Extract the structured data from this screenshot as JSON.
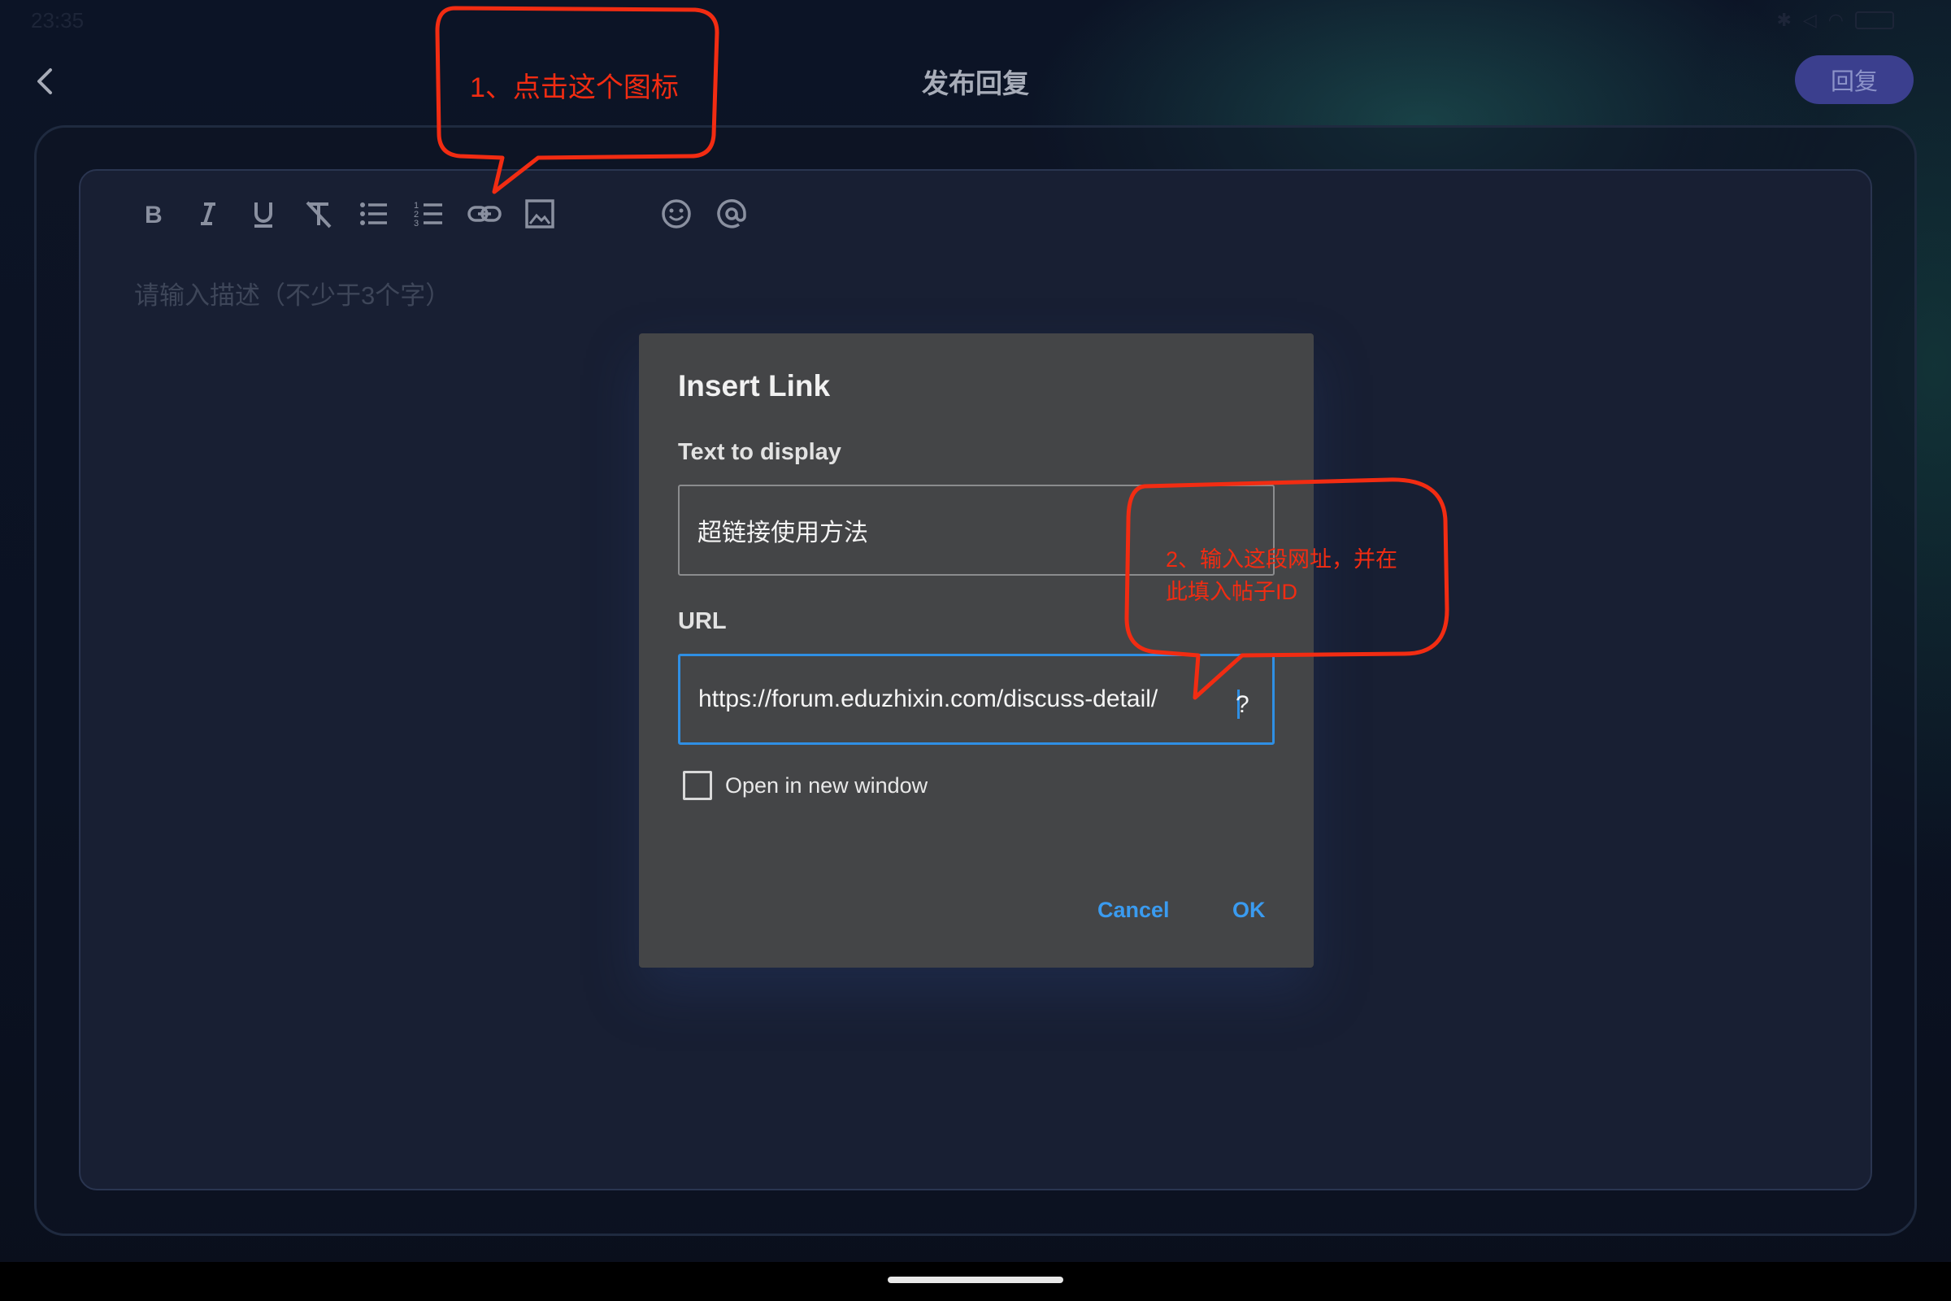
{
  "status_bar": {
    "time": "23:35",
    "icons": [
      "bluetooth-icon",
      "mute-icon",
      "wifi-icon",
      "battery-icon"
    ]
  },
  "header": {
    "title": "发布回复",
    "reply_button": "回复",
    "back_icon": "chevron-left-icon"
  },
  "editor": {
    "placeholder": "请输入描述（不少于3个字）",
    "toolbar": [
      {
        "name": "bold-icon",
        "label": "B"
      },
      {
        "name": "italic-icon",
        "label": "I"
      },
      {
        "name": "underline-icon",
        "label": "U"
      },
      {
        "name": "clear-format-icon"
      },
      {
        "name": "bullet-list-icon"
      },
      {
        "name": "numbered-list-icon"
      },
      {
        "name": "link-icon"
      },
      {
        "name": "image-icon"
      },
      {
        "name": "emoji-icon"
      },
      {
        "name": "mention-icon"
      }
    ]
  },
  "dialog": {
    "title": "Insert Link",
    "text_label": "Text to display",
    "text_value": "超链接使用方法",
    "url_label": "URL",
    "url_value": "https://forum.eduzhixin.com/discuss-detail/",
    "url_trailing": "?",
    "open_new_window_label": "Open in new window",
    "open_new_window_checked": false,
    "cancel": "Cancel",
    "ok": "OK",
    "accent_color": "#2f8fe4"
  },
  "annotations": {
    "step1": "1、点击这个图标",
    "step2_line1": "2、输入这段网址，并在",
    "step2_line2": "此填入帖子ID",
    "color": "#f22c12"
  }
}
